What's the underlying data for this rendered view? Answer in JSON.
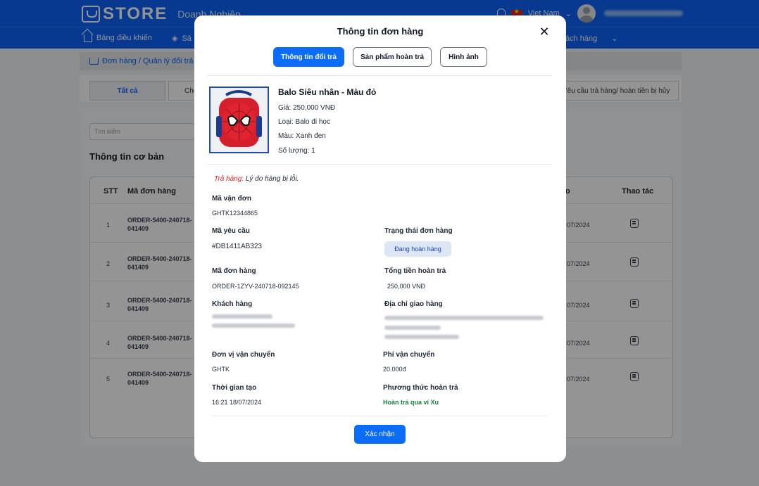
{
  "header": {
    "logo_text": "STORE",
    "logo_subtitle": "Doanh Nghiệp",
    "language": "Viet Nam"
  },
  "nav": {
    "items": [
      {
        "label": "Bảng điều khiển"
      },
      {
        "label": "Sả"
      },
      {
        "label": "ách hàng"
      }
    ]
  },
  "breadcrumb": "Đơn hàng / Quản lý đổi trả",
  "background_tabs": {
    "all": "Tất cả",
    "partial": "Chờ",
    "right": "Yêu cầu trả hàng/ hoàn tiền bị hủy"
  },
  "search": {
    "placeholder": "Tìm kiếm"
  },
  "section_title": "Thông tin cơ bản",
  "table": {
    "headers": {
      "stt": "STT",
      "order": "Mã đơn hàng",
      "date": "o",
      "action": "Thao tác"
    },
    "rows": [
      {
        "stt": "1",
        "order": "ORDER-5400-240718-041409",
        "date": "07/2024"
      },
      {
        "stt": "2",
        "order": "ORDER-5400-240718-041409",
        "date": "07/2024"
      },
      {
        "stt": "3",
        "order": "ORDER-5400-240718-041409",
        "date": "07/2024"
      },
      {
        "stt": "4",
        "order": "ORDER-5400-240718-041409",
        "date": "07/2024"
      },
      {
        "stt": "5",
        "order": "ORDER-5400-240718-041409",
        "date": "07/2024"
      }
    ]
  },
  "modal": {
    "title": "Thông tin đơn hàng",
    "tabs": [
      "Thông tin đổi trả",
      "Sản phẩm hoàn trả",
      "Hình ảnh"
    ],
    "product": {
      "name": "Balo Siêu nhân - Màu đỏ",
      "price": "Giá: 250,000 VNĐ",
      "category": "Loại: Balo đi học",
      "color": "Màu: Xanh đen",
      "quantity": "Số lượng: 1"
    },
    "reason_label": "Trả hàng:",
    "reason_text": " Lý do hàng bị lỗi.",
    "fields": {
      "shipping_code_label": "Mã vận đơn",
      "shipping_code": "GHTK12344865",
      "request_code_label": "Mã yêu cầu",
      "request_code": "#DB1411AB323",
      "order_status_label": "Trạng thái đơn hàng",
      "order_status": "Đang hoàn hàng",
      "order_code_label": "Mã đơn hàng",
      "order_code": "ORDER-1ZYV-240718-092145",
      "refund_total_label": "Tổng tiền hoàn trả",
      "refund_total": "250,000 VNĐ",
      "customer_label": "Khách hàng",
      "address_label": "Địa chỉ giao hàng",
      "carrier_label": "Đơn vị vận chuyển",
      "carrier": "GHTK",
      "shipping_fee_label": "Phí vận chuyển",
      "shipping_fee": "20.000đ",
      "created_label": "Thời gian tạo",
      "created": "16:21 18/07/2024",
      "refund_method_label": "Phương thức hoàn trả",
      "refund_method": "Hoàn trả qua ví Xu"
    },
    "confirm_label": "Xác nhận"
  },
  "colors": {
    "primary": "#0b63f6",
    "danger": "#e02424",
    "success": "#15803d"
  }
}
